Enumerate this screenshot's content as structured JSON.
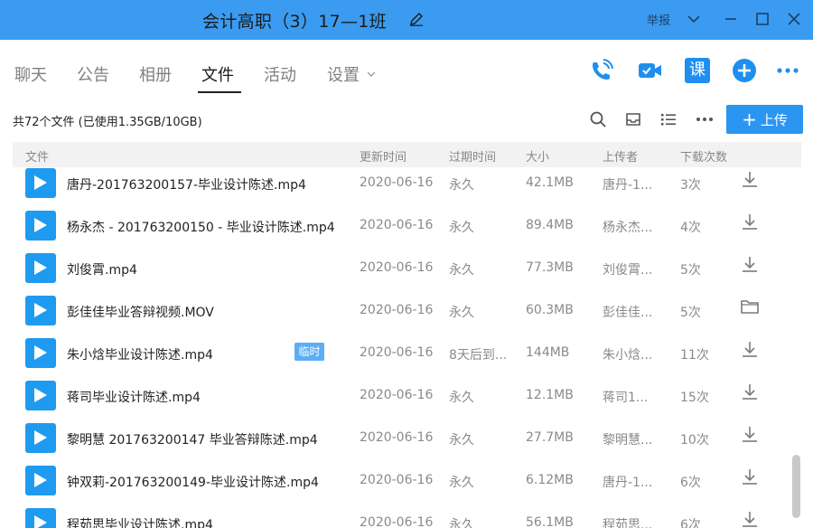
{
  "window": {
    "title": "会计高职（3）17—1班",
    "report_label": "举报",
    "accent_color": "#3a9bf0"
  },
  "tabs": [
    {
      "label": "聊天",
      "active": false
    },
    {
      "label": "公告",
      "active": false
    },
    {
      "label": "相册",
      "active": false
    },
    {
      "label": "文件",
      "active": true
    },
    {
      "label": "活动",
      "active": false
    },
    {
      "label": "设置",
      "active": false
    }
  ],
  "actions": {
    "icons": [
      "phone-icon",
      "video-call-icon",
      "lesson-icon",
      "add-icon",
      "more-icon"
    ],
    "lesson_label": "课"
  },
  "toolbar": {
    "summary": "共72个文件 (已使用1.35GB/10GB)",
    "upload_label": "上传",
    "icons": [
      "search-icon",
      "inbox-icon",
      "list-view-icon",
      "more-icon"
    ]
  },
  "table": {
    "columns": [
      "文件",
      "更新时间",
      "过期时间",
      "大小",
      "上传者",
      "下载次数"
    ],
    "rows": [
      {
        "name": "唐丹-201763200157-毕业设计陈述.mp4",
        "tag": "",
        "updated": "2020-06-16",
        "expires": "永久",
        "size": "42.1MB",
        "uploader": "唐丹-1...",
        "downloads": "3次",
        "action": "download-icon"
      },
      {
        "name": "杨永杰 - 201763200150 - 毕业设计陈述.mp4",
        "tag": "",
        "updated": "2020-06-16",
        "expires": "永久",
        "size": "89.4MB",
        "uploader": "杨永杰...",
        "downloads": "4次",
        "action": "download-icon"
      },
      {
        "name": "刘俊霄.mp4",
        "tag": "",
        "updated": "2020-06-16",
        "expires": "永久",
        "size": "77.3MB",
        "uploader": "刘俊霄...",
        "downloads": "5次",
        "action": "download-icon"
      },
      {
        "name": "彭佳佳毕业答辩视频.MOV",
        "tag": "",
        "updated": "2020-06-16",
        "expires": "永久",
        "size": "60.3MB",
        "uploader": "彭佳佳...",
        "downloads": "5次",
        "action": "folder-icon"
      },
      {
        "name": "朱小焓毕业设计陈述.mp4",
        "tag": "临时",
        "updated": "2020-06-16",
        "expires": "8天后到...",
        "size": "144MB",
        "uploader": "朱小焓...",
        "downloads": "11次",
        "action": "download-icon"
      },
      {
        "name": "蒋司毕业设计陈述.mp4",
        "tag": "",
        "updated": "2020-06-16",
        "expires": "永久",
        "size": "12.1MB",
        "uploader": "蒋司1...",
        "downloads": "15次",
        "action": "download-icon"
      },
      {
        "name": "黎明慧 201763200147 毕业答辩陈述.mp4",
        "tag": "",
        "updated": "2020-06-16",
        "expires": "永久",
        "size": "27.7MB",
        "uploader": "黎明慧...",
        "downloads": "10次",
        "action": "download-icon"
      },
      {
        "name": "钟双莉-201763200149-毕业设计陈述.mp4",
        "tag": "",
        "updated": "2020-06-16",
        "expires": "永久",
        "size": "6.12MB",
        "uploader": "唐丹-1...",
        "downloads": "6次",
        "action": "download-icon"
      },
      {
        "name": "程茹思毕业设计陈述.mp4",
        "tag": "",
        "updated": "2020-06-16",
        "expires": "永久",
        "size": "56.1MB",
        "uploader": "程茹思...",
        "downloads": "6次",
        "action": "download-icon"
      }
    ]
  }
}
